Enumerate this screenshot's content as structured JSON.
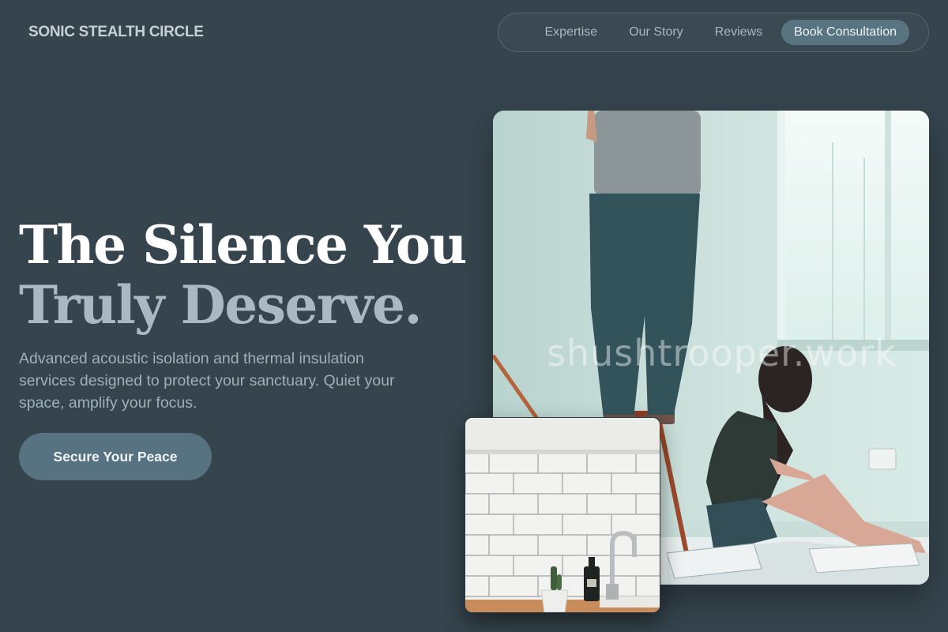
{
  "header": {
    "brand": "SONIC STEALTH CIRCLE",
    "nav": [
      {
        "label": "Expertise"
      },
      {
        "label": "Our Story"
      },
      {
        "label": "Reviews"
      }
    ],
    "cta_label": "Book Consultation"
  },
  "hero": {
    "headline_line1": "The Silence You",
    "headline_line2": "Truly Deserve.",
    "lede": "Advanced acoustic isolation and thermal insulation services designed to protect your sanctuary. Quiet your space, amplify your focus.",
    "cta_label": "Secure Your Peace",
    "watermark": "shushtrooper.work"
  },
  "colors": {
    "background": "#35444d",
    "accent": "#577280",
    "headline_muted": "#a9b8c1"
  }
}
